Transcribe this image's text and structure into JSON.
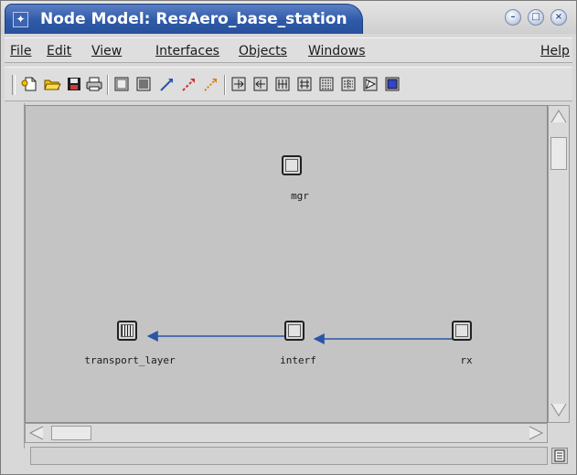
{
  "window": {
    "title": "Node Model: ResAero_base_station",
    "app_icon": "opnet-node-icon",
    "controls": [
      "minimize",
      "maximize",
      "close"
    ]
  },
  "menu": {
    "file": "File",
    "edit": "Edit",
    "view": "View",
    "interfaces": "Interfaces",
    "objects": "Objects",
    "windows": "Windows",
    "help": "Help"
  },
  "toolbar": {
    "buttons": [
      "new-icon",
      "open-folder-icon",
      "save-icon",
      "print-icon",
      "processor-icon",
      "queue-icon",
      "packet-stream-icon",
      "statistic-wire-icon",
      "logical-association-icon",
      "point-to-point-transmitter-icon",
      "point-to-point-receiver-icon",
      "bus-transmitter-icon",
      "bus-receiver-icon",
      "radio-transmitter-icon",
      "radio-receiver-icon",
      "antenna-icon",
      "external-system-icon"
    ]
  },
  "canvas": {
    "background": "#c4c4c4",
    "link_color": "#2a55a8",
    "nodes": [
      {
        "id": "mgr",
        "label": "mgr",
        "kind": "processor"
      },
      {
        "id": "transport_layer",
        "label": "transport_layer",
        "kind": "queue"
      },
      {
        "id": "interf",
        "label": "interf",
        "kind": "processor"
      },
      {
        "id": "rx",
        "label": "rx",
        "kind": "receiver"
      }
    ],
    "streams": [
      {
        "from": "rx",
        "to": "interf"
      },
      {
        "from": "interf",
        "to": "transport_layer"
      }
    ]
  },
  "statusbar": {
    "message": "",
    "icon": "clipboard-icon"
  }
}
